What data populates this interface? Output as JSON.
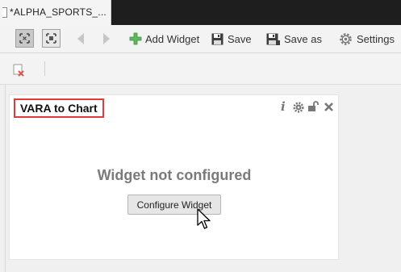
{
  "tab": {
    "title": "*ALPHA_SPORTS_..."
  },
  "toolbar": {
    "add_widget_label": "Add Widget",
    "save_label": "Save",
    "save_as_label": "Save as",
    "settings_label": "Settings"
  },
  "widget": {
    "title": "VARA to Chart",
    "status_text": "Widget not configured",
    "configure_label": "Configure Widget"
  },
  "icons": {
    "info": "info-icon",
    "gear": "gear-icon",
    "unlock": "unlock-icon",
    "close": "close-icon"
  }
}
